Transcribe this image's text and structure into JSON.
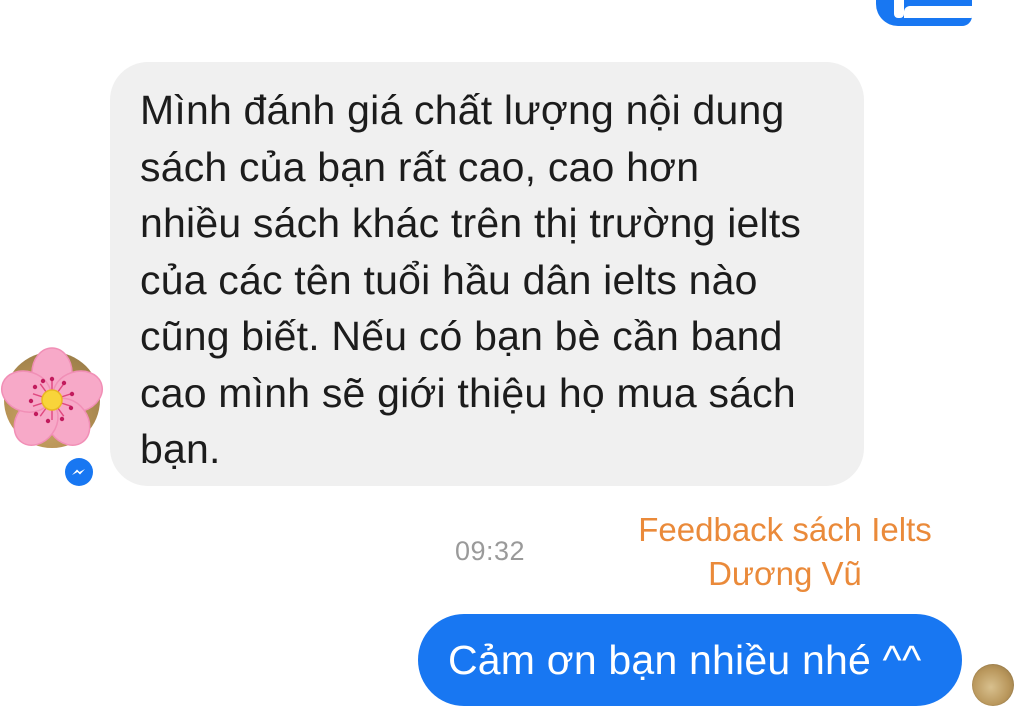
{
  "conversation": {
    "top_sent_bubble": {
      "color": "#1877f2"
    },
    "received_message": {
      "lines": [
        "Mình đánh giá chất lượng nội dung",
        "sách của bạn rất cao, cao hơn",
        "nhiều sách khác trên thị trường ielts",
        "của các tên tuổi hầu dân ielts nào",
        "cũng biết. Nếu có bạn bè cần band",
        "cao mình sẽ giới thiệu họ mua sách",
        "bạn."
      ],
      "avatar_icon": "pink-flower-avatar",
      "badge_icon": "messenger-icon"
    },
    "timestamp": "09:32",
    "watermark": {
      "line1": "Feedback sách Ielts",
      "line2": "Dương Vũ",
      "color": "#ea8a3a"
    },
    "sent_message": {
      "text": "Cảm ơn bạn nhiều nhé ^^",
      "color": "#1877f2"
    },
    "read_receipt_icon": "user-avatar"
  }
}
